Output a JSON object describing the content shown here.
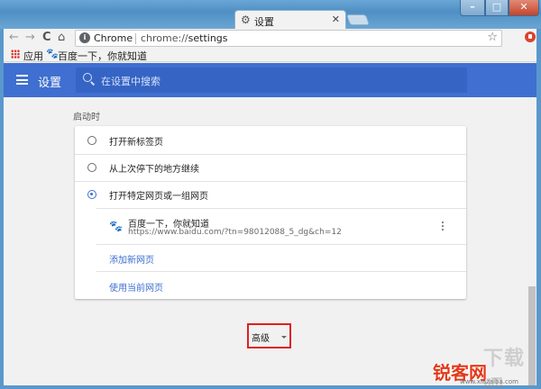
{
  "tab": {
    "title": "设置",
    "close_glyph": "✕"
  },
  "window_controls": {
    "minimize": "–",
    "maximize": "□",
    "close": "✕"
  },
  "toolbar": {
    "back": "←",
    "forward": "→",
    "reload": "C",
    "home": "⌂"
  },
  "omnibox": {
    "site_label": "Chrome",
    "url_scheme": "chrome://",
    "url_path": "settings",
    "star": "☆"
  },
  "bookmarks": {
    "apps_label": "应用",
    "baidu_label": "百度一下，你就知道"
  },
  "settings": {
    "title": "设置",
    "search_placeholder": "在设置中搜索",
    "on_startup": {
      "label": "启动时",
      "options": [
        {
          "label": "打开新标签页",
          "checked": false
        },
        {
          "label": "从上次停下的地方继续",
          "checked": false
        },
        {
          "label": "打开特定网页或一组网页",
          "checked": true
        }
      ],
      "pages": [
        {
          "title": "百度一下，你就知道",
          "url": "https://www.baidu.com/?tn=98012088_5_dg&ch=12"
        }
      ],
      "add_page_link": "添加新网页",
      "use_current_link": "使用当前网页"
    },
    "advanced_label": "高级"
  },
  "watermark": {
    "big": "下载吧",
    "brand": "锐客网",
    "url": "www.xiazaiba.com"
  },
  "colors": {
    "accent": "#3f6fd0",
    "header": "#3f6fd0",
    "highlight": "#e02020"
  }
}
